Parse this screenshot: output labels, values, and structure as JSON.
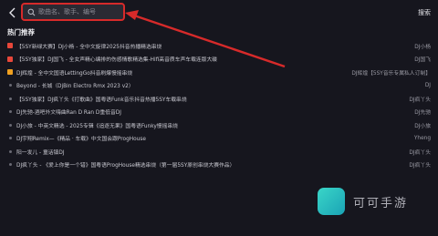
{
  "header": {
    "search_placeholder": "歌曲名、歌手、编号",
    "search_button": "搜索"
  },
  "section": {
    "title": "热门推荐"
  },
  "hot_list": [
    {
      "badge": "red",
      "title": "【5SY新绿大赛】DJ小杨 - 全中文旋律2025抖音热播精选串烧",
      "artist": "DJ小杨"
    },
    {
      "badge": "red",
      "title": "【5SY独家】DJ国飞 - 全女声精心编排的伤感情歌精选集-Hifi高音质车声车载连版大碟",
      "artist": "DJ国飞"
    },
    {
      "badge": "orange",
      "title": "DJ辉煌 - 全中文国语LettingGo抖音刷爆慢摇串烧",
      "artist": "DJ辉煌【5SY音乐专属私人订制】"
    },
    {
      "badge": "dot",
      "title": "Beyond - 长城（DjBin Electro Rmx 2023 v2）",
      "artist": "DJ"
    },
    {
      "badge": "dot",
      "title": "【5SY独家】DJ疯丫头《打歌曲》国粤语Funk音乐抖音热播5SY车载串烧",
      "artist": "DJ疯丫头"
    },
    {
      "badge": "dot",
      "title": "DJ先驰-酒吧外文嗨曲Ran D Ran D重低音DJ",
      "artist": "DJ先驰"
    },
    {
      "badge": "dot",
      "title": "DJ小旅 - 中英文精选 - 2025专辑《追逐无果》国粤语Funky慢摇串烧",
      "artist": "DJ小旅"
    },
    {
      "badge": "dot",
      "title": "DJ宇翔Remix—《精品 · 车载》中文国会跟ProgHouse",
      "artist": "Yheng"
    },
    {
      "badge": "dot",
      "title": "阳一发儿 - 童话镇DJ",
      "artist": "DJ疯丫头"
    },
    {
      "badge": "dot",
      "title": "DJ疯丫头 - 《爱上你是一个错》国粤语ProgHouse精选串烧（第一届5SY原创串烧大赛作品）",
      "artist": "DJ疯丫头"
    }
  ],
  "watermark": {
    "logo_char": "可",
    "text": "可可手游"
  },
  "colors": {
    "background": "#16161e",
    "highlight_red": "#d72a2a",
    "badge_red": "#e8473a",
    "badge_orange": "#f0a020",
    "accent_teal": "#2ac2c0"
  }
}
